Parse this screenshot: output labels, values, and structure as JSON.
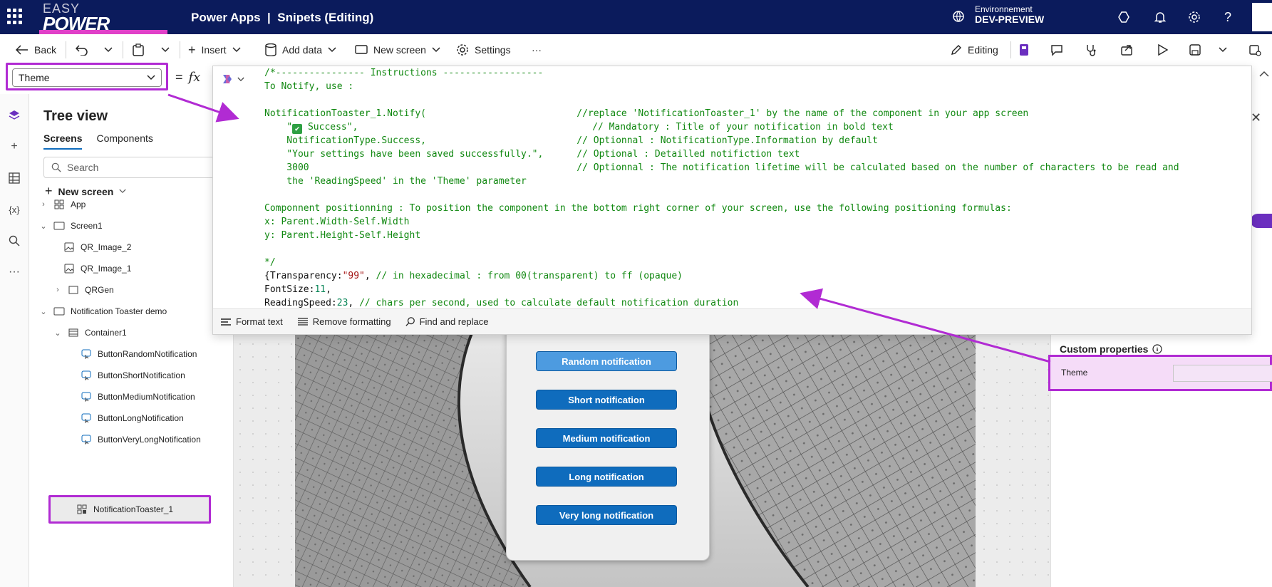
{
  "header": {
    "logo_top": "EASY",
    "logo_bottom": "POWER PLATFORM",
    "app_title": "Power Apps  |  Snipets (Editing)",
    "env_label": "Environnement",
    "env_name": "DEV-PREVIEW",
    "icons": [
      "waffle-icon",
      "environment-icon",
      "copilot-icon",
      "bell-icon",
      "gear-icon",
      "help-icon"
    ]
  },
  "commandbar": {
    "back": "Back",
    "insert": "Insert",
    "add_data": "Add data",
    "new_screen": "New screen",
    "settings": "Settings",
    "more": "···",
    "editing": "Editing"
  },
  "formula": {
    "property": "Theme",
    "equals": "=",
    "fx": "fx"
  },
  "tree": {
    "title": "Tree view",
    "tabs": [
      "Screens",
      "Components"
    ],
    "search_placeholder": "Search",
    "new_screen": "New screen",
    "items": [
      {
        "label": "App"
      },
      {
        "label": "Screen1"
      },
      {
        "label": "QR_Image_2"
      },
      {
        "label": "QR_Image_1"
      },
      {
        "label": "QRGen"
      },
      {
        "label": "Notification Toaster demo"
      },
      {
        "label": "Container1"
      },
      {
        "label": "ButtonRandomNotification"
      },
      {
        "label": "ButtonShortNotification"
      },
      {
        "label": "ButtonMediumNotification"
      },
      {
        "label": "ButtonLongNotification"
      },
      {
        "label": "ButtonVeryLongNotification"
      },
      {
        "label": "NotificationToaster_1"
      }
    ]
  },
  "editor": {
    "footer": {
      "format": "Format text",
      "remove": "Remove formatting",
      "find": "Find and replace"
    }
  },
  "canvas": {
    "buttons": [
      "Random notification",
      "Short notification",
      "Medium notification",
      "Long notification",
      "Very long notification"
    ]
  },
  "properties": {
    "custom_header": "Custom properties",
    "theme_label": "Theme"
  },
  "colors": {
    "header_bg": "#0b1b5c",
    "highlight": "#b12bd3",
    "button_blue": "#0f6cbd",
    "comment_green": "#108810"
  }
}
